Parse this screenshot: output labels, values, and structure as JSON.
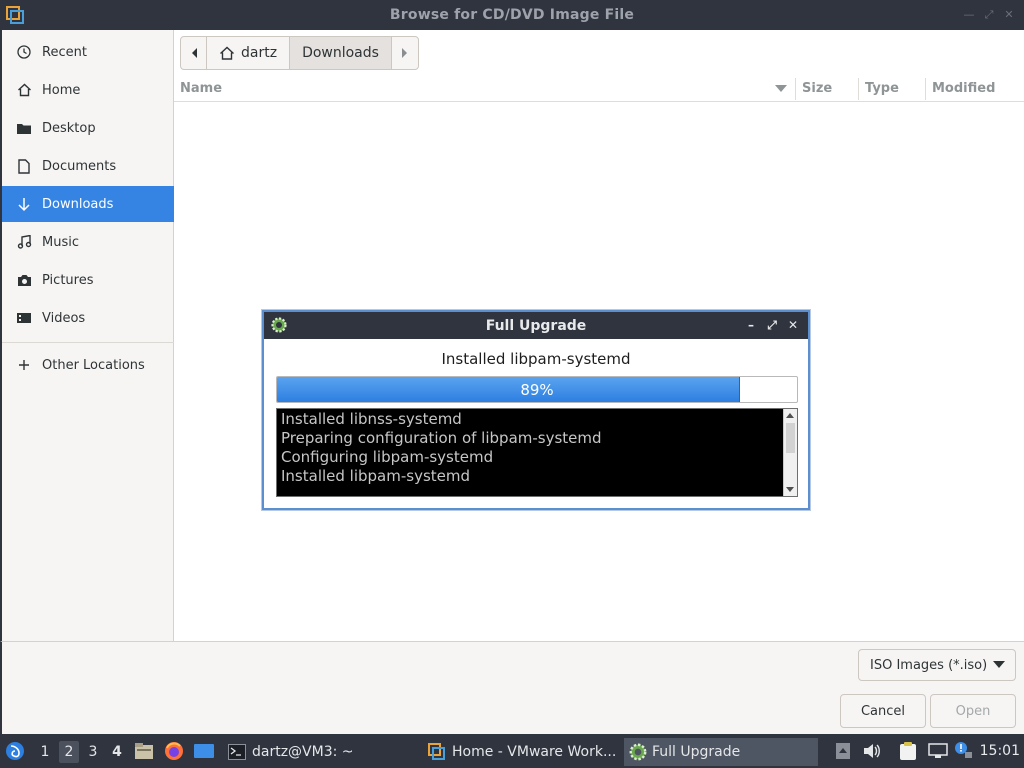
{
  "window": {
    "title": "Browse for CD/DVD Image File"
  },
  "sidebar": {
    "items": [
      {
        "label": "Recent",
        "icon": "clock-icon"
      },
      {
        "label": "Home",
        "icon": "home-icon"
      },
      {
        "label": "Desktop",
        "icon": "folder-icon"
      },
      {
        "label": "Documents",
        "icon": "document-icon"
      },
      {
        "label": "Downloads",
        "icon": "download-icon",
        "active": true
      },
      {
        "label": "Music",
        "icon": "music-icon"
      },
      {
        "label": "Pictures",
        "icon": "camera-icon"
      },
      {
        "label": "Videos",
        "icon": "video-icon"
      },
      {
        "label": "Other Locations",
        "icon": "plus-icon"
      }
    ]
  },
  "pathbar": {
    "home_label": "dartz",
    "current_label": "Downloads"
  },
  "list_header": {
    "name": "Name",
    "size": "Size",
    "type": "Type",
    "modified": "Modified"
  },
  "footer": {
    "filter_label": "ISO Images (*.iso)",
    "cancel_label": "Cancel",
    "open_label": "Open"
  },
  "dialog": {
    "title": "Full Upgrade",
    "status": "Installed libpam-systemd",
    "progress_percent": 89,
    "progress_label": "89%",
    "log_lines": [
      "Installed libnss-systemd",
      "Preparing configuration of libpam-systemd",
      "Configuring libpam-systemd",
      "Installed libpam-systemd"
    ]
  },
  "taskbar": {
    "desktops": [
      "1",
      "2",
      "3",
      "4"
    ],
    "active_desktop": "2",
    "tasks": [
      {
        "label": "dartz@VM3: ~",
        "icon": "terminal-icon"
      },
      {
        "label": "Home - VMware Work...",
        "icon": "vmware-icon"
      },
      {
        "label": "Full Upgrade",
        "icon": "gear-icon",
        "active": true
      }
    ],
    "clock": "15:01"
  },
  "colors": {
    "accent": "#3584e4",
    "titlebar": "#2f343f",
    "progress": "#3b8ce8"
  }
}
